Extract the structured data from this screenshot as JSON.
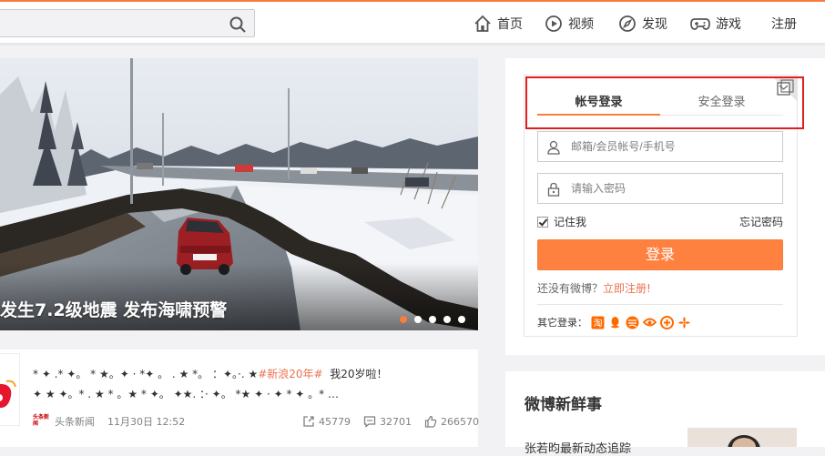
{
  "header": {
    "search_placeholder": "",
    "nav": [
      {
        "label": "首页",
        "icon": "home-icon"
      },
      {
        "label": "视频",
        "icon": "video-icon"
      },
      {
        "label": "发现",
        "icon": "compass-icon"
      },
      {
        "label": "游戏",
        "icon": "gamepad-icon"
      },
      {
        "label": "注册"
      }
    ]
  },
  "banner": {
    "caption": "发生7.2级地震 发布海啸预警",
    "dots_count": 5,
    "active_dot": 1
  },
  "feed": {
    "text_line1_prefix": "* ✦  .*  ✦。 * ★。✦  · *✦   。  . ★ *。  ：✦。·. ★",
    "text_line1_tag": "#新浪20年#",
    "text_line1_suffix": "我20岁啦！",
    "text_line2": "✦   ★ ✦。* . ★ * 。★   *  ✦。 ✦★.   ：· ✦。 *★  ✦  · ✦ * ✦ 。*  …",
    "source_logo": "头条新闻",
    "source": "头条新闻",
    "date": "11月30日 12:52",
    "repost_count": "45779",
    "comment_count": "32701",
    "like_count": "266570"
  },
  "login": {
    "tab_account": "帐号登录",
    "tab_safe": "安全登录",
    "username_placeholder": "邮箱/会员帐号/手机号",
    "password_placeholder": "请输入密码",
    "remember_label": "记住我",
    "forgot_label": "忘记密码",
    "login_button": "登录",
    "no_account_text": "还没有微博？",
    "register_link": "立即注册!",
    "other_login_label": "其它登录："
  },
  "sidebar": {
    "fresh_title": "微博新鲜事",
    "fresh_item": "张若昀最新动态追踪"
  },
  "colors": {
    "accent": "#fa7d3c",
    "highlight_box": "#e01d20"
  }
}
